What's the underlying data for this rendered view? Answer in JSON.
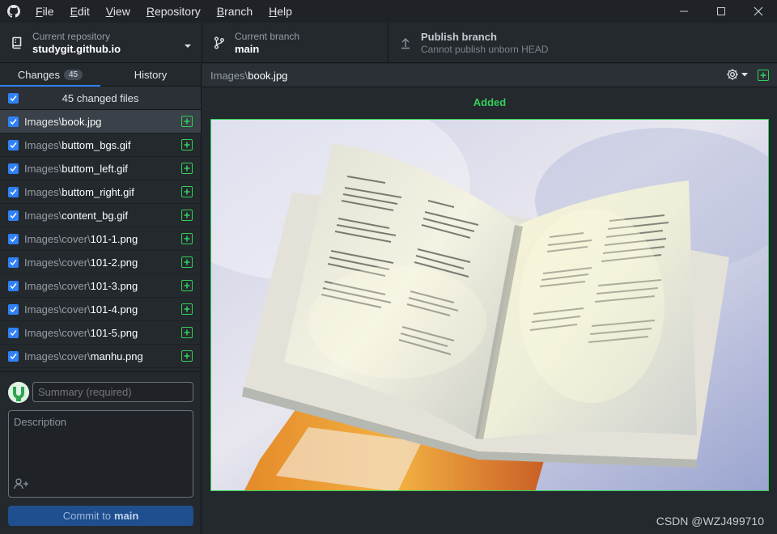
{
  "menu": [
    {
      "label": "File",
      "mnemonic": "F",
      "rest": "ile"
    },
    {
      "label": "Edit",
      "mnemonic": "E",
      "rest": "dit"
    },
    {
      "label": "View",
      "mnemonic": "V",
      "rest": "iew"
    },
    {
      "label": "Repository",
      "mnemonic": "R",
      "rest": "epository"
    },
    {
      "label": "Branch",
      "mnemonic": "B",
      "rest": "ranch"
    },
    {
      "label": "Help",
      "mnemonic": "H",
      "rest": "elp"
    }
  ],
  "toolbar": {
    "repo_label": "Current repository",
    "repo_value": "studygit.github.io",
    "branch_label": "Current branch",
    "branch_value": "main",
    "publish_title": "Publish branch",
    "publish_sub": "Cannot publish unborn HEAD"
  },
  "tabs": {
    "changes_label": "Changes",
    "changes_count": "45",
    "history_label": "History"
  },
  "changes": {
    "header": "45 changed files",
    "files": [
      {
        "dir": "Images\\",
        "name": "book.jpg"
      },
      {
        "dir": "Images\\",
        "name": "buttom_bgs.gif"
      },
      {
        "dir": "Images\\",
        "name": "buttom_left.gif"
      },
      {
        "dir": "Images\\",
        "name": "buttom_right.gif"
      },
      {
        "dir": "Images\\",
        "name": "content_bg.gif"
      },
      {
        "dir": "Images\\cover\\",
        "name": "101-1.png"
      },
      {
        "dir": "Images\\cover\\",
        "name": "101-2.png"
      },
      {
        "dir": "Images\\cover\\",
        "name": "101-3.png"
      },
      {
        "dir": "Images\\cover\\",
        "name": "101-4.png"
      },
      {
        "dir": "Images\\cover\\",
        "name": "101-5.png"
      },
      {
        "dir": "Images\\cover\\",
        "name": "manhu.png"
      }
    ]
  },
  "commit": {
    "summary_placeholder": "Summary (required)",
    "description_placeholder": "Description",
    "button_prefix": "Commit to",
    "button_branch": "main"
  },
  "main": {
    "path_dir": "Images\\",
    "path_name": "book.jpg",
    "status": "Added"
  },
  "watermark": "CSDN @WZJ499710",
  "colors": {
    "accent": "#2f81f7",
    "added": "#34d058"
  }
}
